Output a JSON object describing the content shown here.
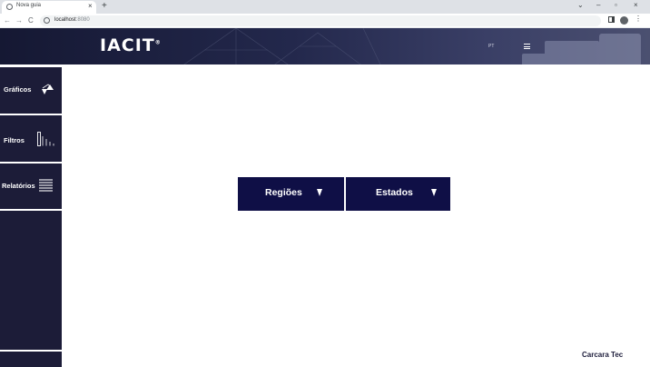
{
  "browser": {
    "tab_title": "Nova guia",
    "tab_close": "×",
    "new_tab": "+",
    "window_controls": {
      "minimize": "–",
      "maximize": "▫",
      "close": "×",
      "chevron": "⌄"
    },
    "nav": {
      "back": "←",
      "forward": "→",
      "reload": "C"
    },
    "url_host": "localhost",
    "url_port": ":8080",
    "menu": "⋮"
  },
  "header": {
    "logo": "IACIT",
    "logo_mark": "®",
    "language": "PT"
  },
  "sidebar": {
    "items": [
      {
        "label": "Gráficos",
        "icon": "charts-icon"
      },
      {
        "label": "Filtros",
        "icon": "filter-bars-icon"
      },
      {
        "label": "Relatórios",
        "icon": "report-lines-icon"
      }
    ]
  },
  "main": {
    "dropdowns": [
      {
        "label": "Regiões",
        "icon": "caret-down-icon"
      },
      {
        "label": "Estados",
        "icon": "caret-down-icon"
      }
    ]
  },
  "footer": {
    "brand": "Carcara Tec"
  },
  "colors": {
    "sidebar_bg": "#1c1c38",
    "dropdown_bg": "#0f0f46",
    "header_bg": "#23284c"
  }
}
